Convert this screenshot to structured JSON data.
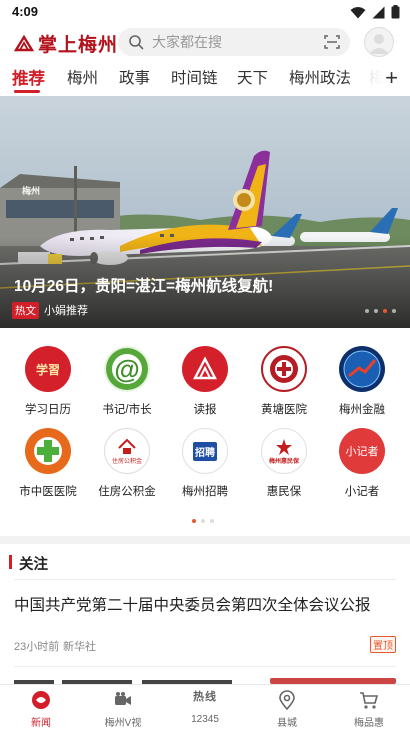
{
  "status_bar": {
    "time": "4:09"
  },
  "header": {
    "logo_text": "掌上梅州",
    "search_placeholder": "大家都在搜"
  },
  "tabs": [
    {
      "label": "推荐",
      "active": true
    },
    {
      "label": "梅州"
    },
    {
      "label": "政事"
    },
    {
      "label": "时间链"
    },
    {
      "label": "天下"
    },
    {
      "label": "梅州政法"
    },
    {
      "label": "梅"
    }
  ],
  "banner": {
    "title": "10月26日，贵阳=湛江=梅州航线复航!",
    "tag": "热文",
    "source": "小娟推荐",
    "airport_sign": "梅州",
    "active_slide": 2,
    "slide_count": 4
  },
  "services": [
    {
      "label": "学习日历",
      "icon": "study-calendar-icon",
      "icon_text": "学習"
    },
    {
      "label": "书记/市长",
      "icon": "at-mail-icon",
      "icon_text": "@"
    },
    {
      "label": "读报",
      "icon": "newspaper-icon",
      "icon_text": ""
    },
    {
      "label": "黄塘医院",
      "icon": "huangtang-hospital-icon",
      "icon_text": ""
    },
    {
      "label": "梅州金融",
      "icon": "finance-icon",
      "icon_text": ""
    },
    {
      "label": "市中医医院",
      "icon": "tcm-hospital-icon",
      "icon_text": ""
    },
    {
      "label": "住房公积金",
      "icon": "housing-fund-icon",
      "icon_text": "住房公积金"
    },
    {
      "label": "梅州招聘",
      "icon": "recruitment-icon",
      "icon_text": "招聘"
    },
    {
      "label": "惠民保",
      "icon": "insurance-icon",
      "icon_text": "梅州惠民保"
    },
    {
      "label": "小记者",
      "icon": "young-reporter-icon",
      "icon_text": "小记者"
    }
  ],
  "services_page": {
    "active": 0,
    "count": 3
  },
  "follow": {
    "title": "关注",
    "news": [
      {
        "title": "中国共产党第二十届中央委员会第四次全体会议公报",
        "time": "23小时前",
        "source": "新华社",
        "badge": "置顶"
      }
    ]
  },
  "bottom_nav": [
    {
      "label": "新闻",
      "icon": "news-icon",
      "active": true
    },
    {
      "label": "梅州V视",
      "icon": "video-icon"
    },
    {
      "label": "12345",
      "icon": "hotline-icon",
      "icon_text": "热线"
    },
    {
      "label": "县城",
      "icon": "location-icon"
    },
    {
      "label": "梅品惠",
      "icon": "cart-icon"
    }
  ],
  "colors": {
    "brand_red": "#d21f2a",
    "accent_orange": "#e8582c"
  }
}
